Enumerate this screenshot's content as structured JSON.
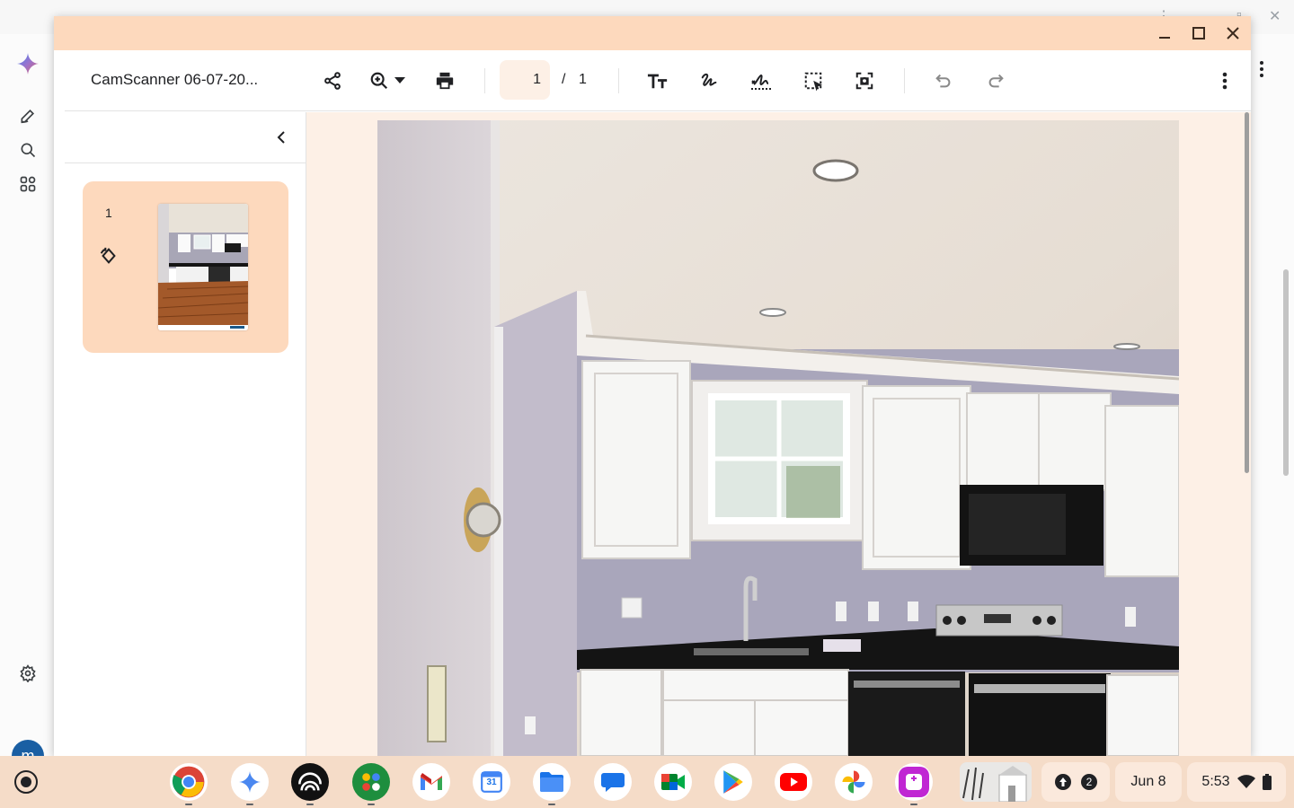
{
  "window": {
    "title_controls": [
      "minimize",
      "maximize",
      "close"
    ]
  },
  "toolbar": {
    "filename": "CamScanner 06-07-20...",
    "current_page": "1",
    "page_separator": "/",
    "total_pages": "1",
    "tools": [
      "share-icon",
      "zoom-icon",
      "zoom-dropdown-icon",
      "print-icon",
      "text-icon",
      "draw-icon",
      "signature-icon",
      "select-area-icon",
      "screenshot-icon",
      "undo-icon",
      "redo-icon",
      "more-icon"
    ]
  },
  "sidebar": {
    "thumbnails": [
      {
        "page_number": "1"
      }
    ]
  },
  "shelf": {
    "apps": [
      "Chrome",
      "Gemini",
      "Podcasts",
      "Google Workspace",
      "Gmail",
      "Calendar",
      "Files",
      "Messages",
      "Meet",
      "Play Store",
      "YouTube",
      "Photos",
      "Screen Recorder"
    ],
    "calendar_day": "31",
    "notification_count": "2",
    "date": "Jun 8",
    "time": "5:53"
  },
  "colors": {
    "accent": "#fdd9bd",
    "viewer_bg": "#fdf0e6",
    "shelf_bg": "#f5dcc8"
  }
}
